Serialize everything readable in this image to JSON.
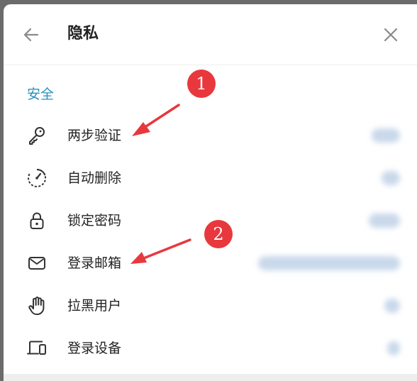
{
  "header": {
    "title": "隐私",
    "back_icon": "arrow-left-icon",
    "close_icon": "close-icon"
  },
  "section": {
    "title": "安全"
  },
  "items": [
    {
      "label": "两步验证",
      "icon": "key-icon"
    },
    {
      "label": "自动删除",
      "icon": "timer-icon"
    },
    {
      "label": "锁定密码",
      "icon": "lock-icon"
    },
    {
      "label": "登录邮箱",
      "icon": "mail-icon"
    },
    {
      "label": "拉黑用户",
      "icon": "hand-icon"
    },
    {
      "label": "登录设备",
      "icon": "devices-icon"
    }
  ],
  "annotations": [
    {
      "number": "1"
    },
    {
      "number": "2"
    }
  ],
  "colors": {
    "accent": "#2a8fbd",
    "annotation": "#e8383d"
  }
}
